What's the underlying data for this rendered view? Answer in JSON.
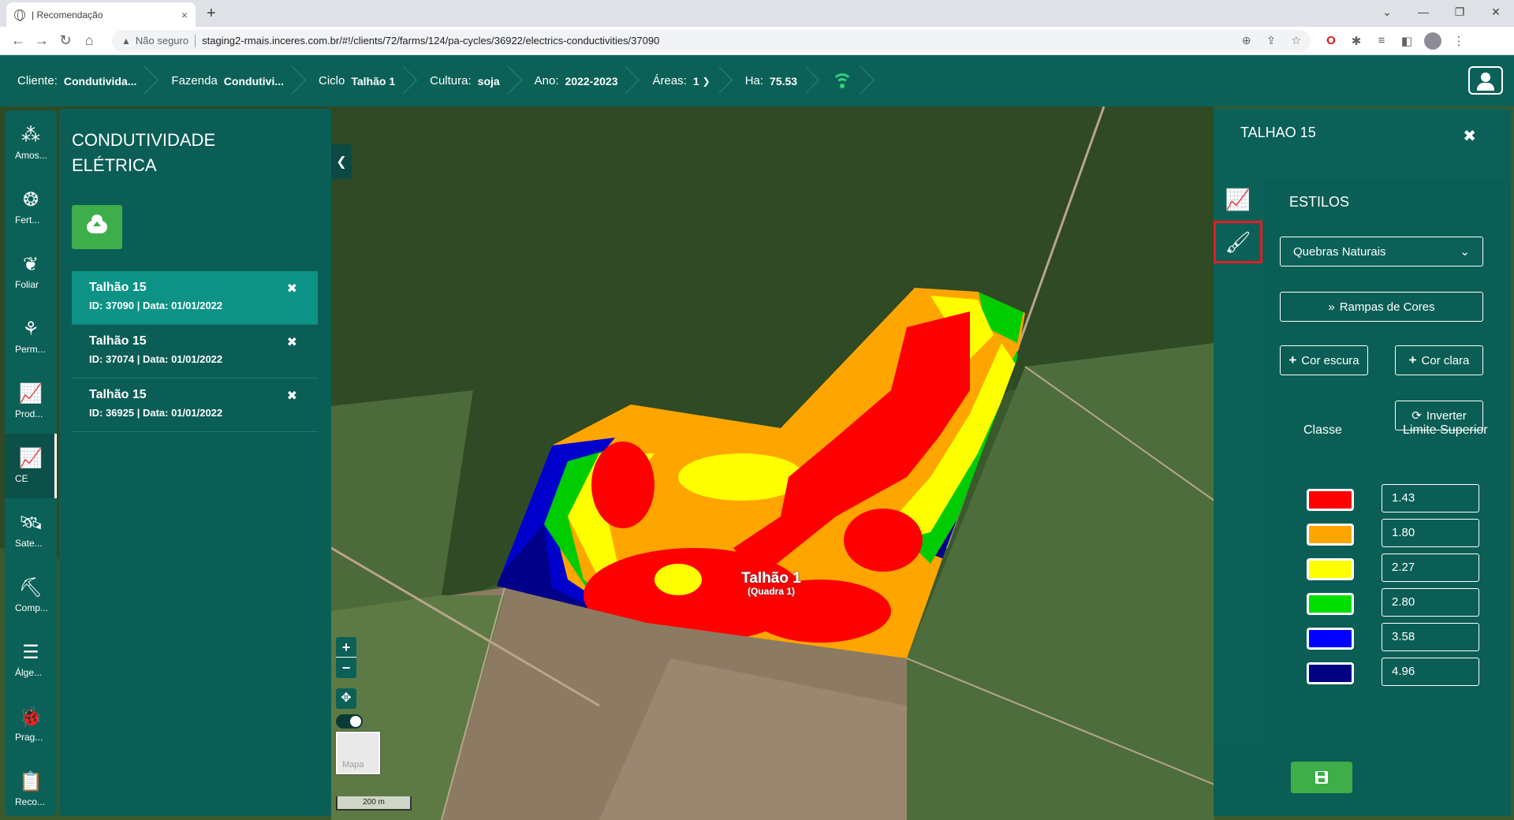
{
  "browser": {
    "tab_title": "| Recomendação",
    "tab_close": "×",
    "new_tab": "+",
    "security_label": "Não seguro",
    "url": "staging2-rmais.inceres.com.br/#!/clients/72/farms/124/pa-cycles/36922/electrics-conductivities/37090"
  },
  "header": {
    "cliente_label": "Cliente:",
    "cliente_value": "Condutivida...",
    "fazenda_label": "Fazenda",
    "fazenda_value": "Condutivi...",
    "ciclo_label": "Ciclo",
    "ciclo_value": "Talhão 1",
    "cultura_label": "Cultura:",
    "cultura_value": "soja",
    "ano_label": "Ano:",
    "ano_value": "2022-2023",
    "areas_label": "Áreas:",
    "areas_value": "1",
    "ha_label": "Ha:",
    "ha_value": "75.53"
  },
  "left_nav": {
    "items": [
      {
        "label": "Amos...",
        "icon": "sample-icon"
      },
      {
        "label": "Fert...",
        "icon": "fertilizer-icon"
      },
      {
        "label": "Foliar",
        "icon": "leaf-icon"
      },
      {
        "label": "Perm...",
        "icon": "plants-icon"
      },
      {
        "label": "Prod...",
        "icon": "chart-icon"
      },
      {
        "label": "CE",
        "icon": "chart-icon"
      },
      {
        "label": "Sate...",
        "icon": "satellite-icon"
      },
      {
        "label": "Comp...",
        "icon": "compaction-icon"
      },
      {
        "label": "Álge...",
        "icon": "layers-icon"
      },
      {
        "label": "Prag...",
        "icon": "bug-icon"
      },
      {
        "label": "Reco...",
        "icon": "recommendation-icon"
      }
    ]
  },
  "ce_panel": {
    "title": "CONDUTIVIDADE ELÉTRICA",
    "items": [
      {
        "name": "Talhão 15",
        "meta": "ID: 37090 | Data: 01/01/2022"
      },
      {
        "name": "Talhão 15",
        "meta": "ID: 37074 | Data: 01/01/2022"
      },
      {
        "name": "Talhão 15",
        "meta": "ID: 36925 | Data: 01/01/2022"
      }
    ]
  },
  "map": {
    "field_label": "Talhão 1",
    "field_sublabel": "(Quadra 1)",
    "basemap_label": "Mapa",
    "scale_label": "200 m"
  },
  "right_panel": {
    "title": "TALHAO 15",
    "section_title": "ESTILOS",
    "method_selected": "Quebras Naturais",
    "ramps_label": "Rampas de Cores",
    "dark_color_label": "Cor escura",
    "light_color_label": "Cor clara",
    "invert_label": "Inverter",
    "class_header": "Classe",
    "limit_header": "Limite Superior",
    "classes": [
      {
        "color": "#ff0000",
        "limit": "1.43"
      },
      {
        "color": "#ffa500",
        "limit": "1.80"
      },
      {
        "color": "#ffff00",
        "limit": "2.27"
      },
      {
        "color": "#00dd00",
        "limit": "2.80"
      },
      {
        "color": "#0000ff",
        "limit": "3.58"
      },
      {
        "color": "#000080",
        "limit": "4.96"
      }
    ]
  },
  "colors": {
    "brand": "#0b6158",
    "panel": "#0b5e55",
    "selected_item": "#0c9386",
    "accent_green": "#3dae49",
    "highlight_red": "#e51b24"
  }
}
